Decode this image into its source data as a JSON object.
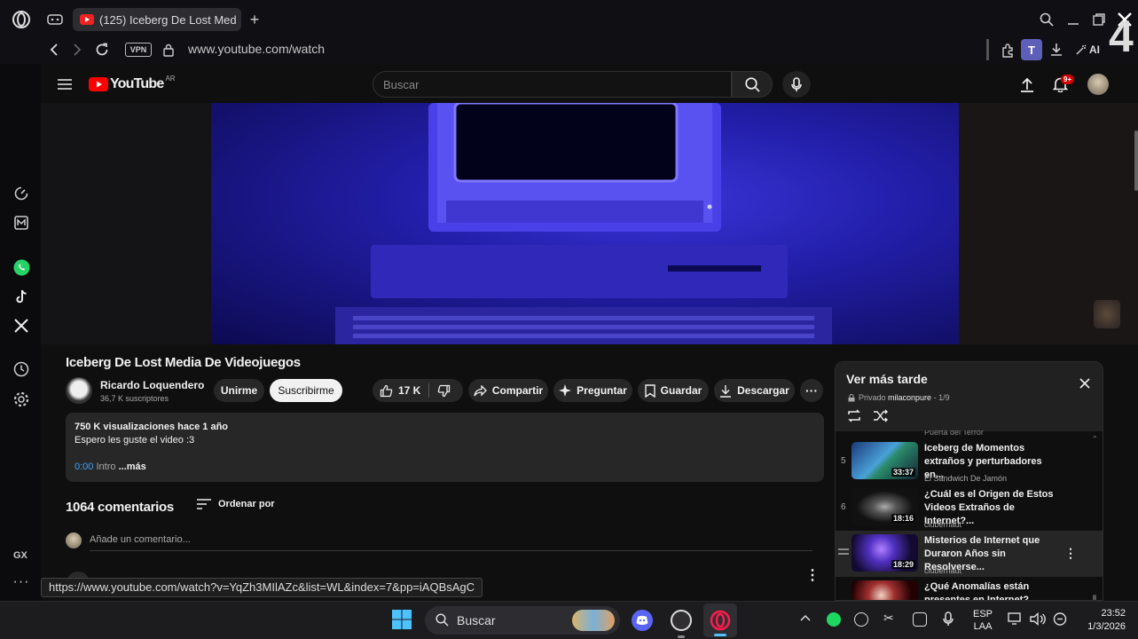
{
  "browser": {
    "tab_title": "(125) Iceberg De Lost Med",
    "vpn_label": "VPN",
    "url": "www.youtube.com/watch",
    "profile_letter": "T",
    "ai_label": "AI",
    "sidebar_label": "GX",
    "status_url": "https://www.youtube.com/watch?v=YqZh3MIlAZc&list=WL&index=7&pp=iAQBsAgC"
  },
  "youtube": {
    "logo_text": "YouTube",
    "region": "AR",
    "search_placeholder": "Buscar",
    "notification_count": "9+"
  },
  "video": {
    "title": "Iceberg De Lost Media De Videojuegos",
    "channel_name": "Ricardo Loquendero",
    "subscribers": "36,7 K suscriptores",
    "join_label": "Unirme",
    "subscribe_label": "Suscribirme",
    "likes": "17 K",
    "share_label": "Compartir",
    "ask_label": "Preguntar",
    "save_label": "Guardar",
    "download_label": "Descargar",
    "views_date": "750 K visualizaciones  hace 1 año",
    "description": "Espero les guste el video :3",
    "chapter_time": "0:00",
    "chapter_name": "Intro",
    "more_label": "...más"
  },
  "comments": {
    "count": "1064 comentarios",
    "sort_label": "Ordenar por",
    "add_placeholder": "Añade un comentario..."
  },
  "playlist": {
    "title": "Ver más tarde",
    "privacy": "Privado",
    "owner": "milaconpure",
    "position": "- 1/9",
    "partial_top": "Puerta del Terror",
    "items": [
      {
        "num": "5",
        "title": "Iceberg de Momentos extraños y perturbadores en...",
        "channel": "El Sándwich De Jamón",
        "duration": "33:37"
      },
      {
        "num": "6",
        "title": "¿Cuál es el Origen de Estos Videos Extraños de Internet?...",
        "channel": "clubernaut",
        "duration": "18:16"
      },
      {
        "num": "",
        "title": "Misterios de Internet que Duraron Años sin Resolverse...",
        "channel": "clubernaut",
        "duration": "18:29"
      },
      {
        "num": "",
        "title": "¿Qué Anomalías están presentes en Internet?",
        "channel": "",
        "duration": ""
      }
    ]
  },
  "taskbar": {
    "search_label": "Buscar",
    "lang_top": "ESP",
    "lang_bottom": "LAA",
    "time": "23:52",
    "date": "1/3/2026"
  },
  "overlay_digit": "4"
}
